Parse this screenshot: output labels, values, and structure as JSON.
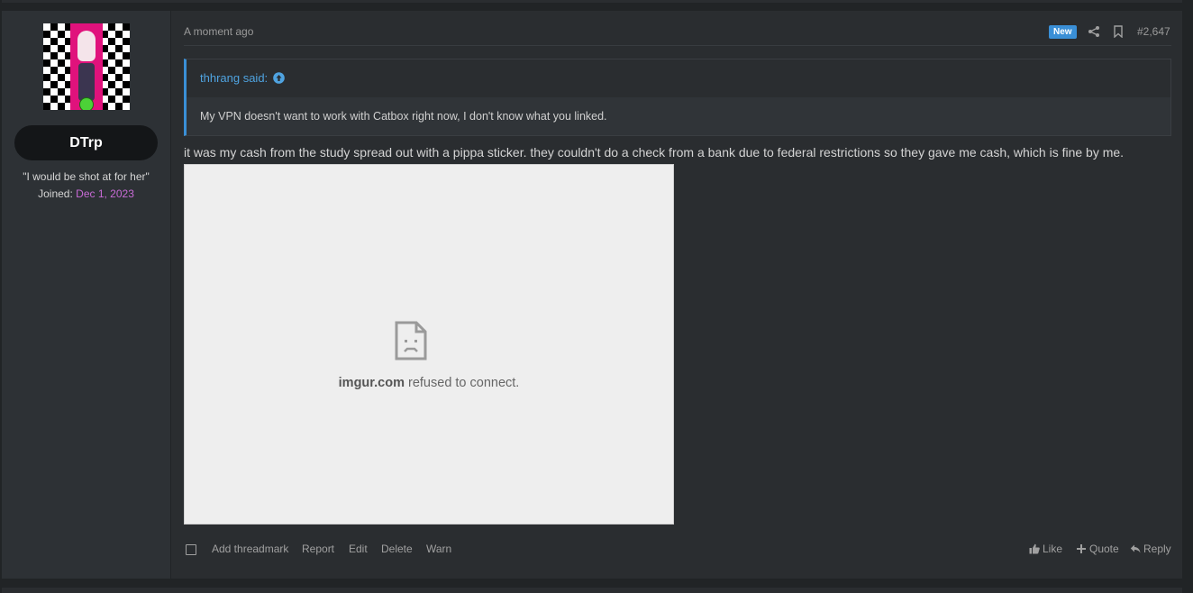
{
  "user": {
    "name": "DTrp",
    "title": "\"I would be shot at for her\"",
    "joined_label": "Joined:",
    "joined_date": "Dec 1, 2023"
  },
  "post": {
    "timestamp": "A moment ago",
    "new_badge": "New",
    "number": "#2,647",
    "quote": {
      "author": "thhrang said:",
      "text": "My VPN doesn't want to work with Catbox right now, I don't know what you linked."
    },
    "body": "it was my cash from the study spread out with a pippa sticker. they couldn't do a check from a bank due to federal restrictions so they gave me cash, which is fine by me.",
    "embed": {
      "domain": "imgur.com",
      "message": " refused to connect."
    }
  },
  "footer": {
    "actions": [
      "Add threadmark",
      "Report",
      "Edit",
      "Delete",
      "Warn"
    ],
    "like": "Like",
    "quote": "Quote",
    "reply": "Reply"
  },
  "colors": {
    "accent": "#3a8fd6",
    "joined_date": "#c86bd6",
    "background": "#2a2d30"
  },
  "icons": [
    "share-icon",
    "bookmark-icon",
    "arrow-up-circle-icon",
    "broken-page-icon",
    "thumbs-up-icon",
    "plus-icon",
    "reply-arrow-icon"
  ]
}
